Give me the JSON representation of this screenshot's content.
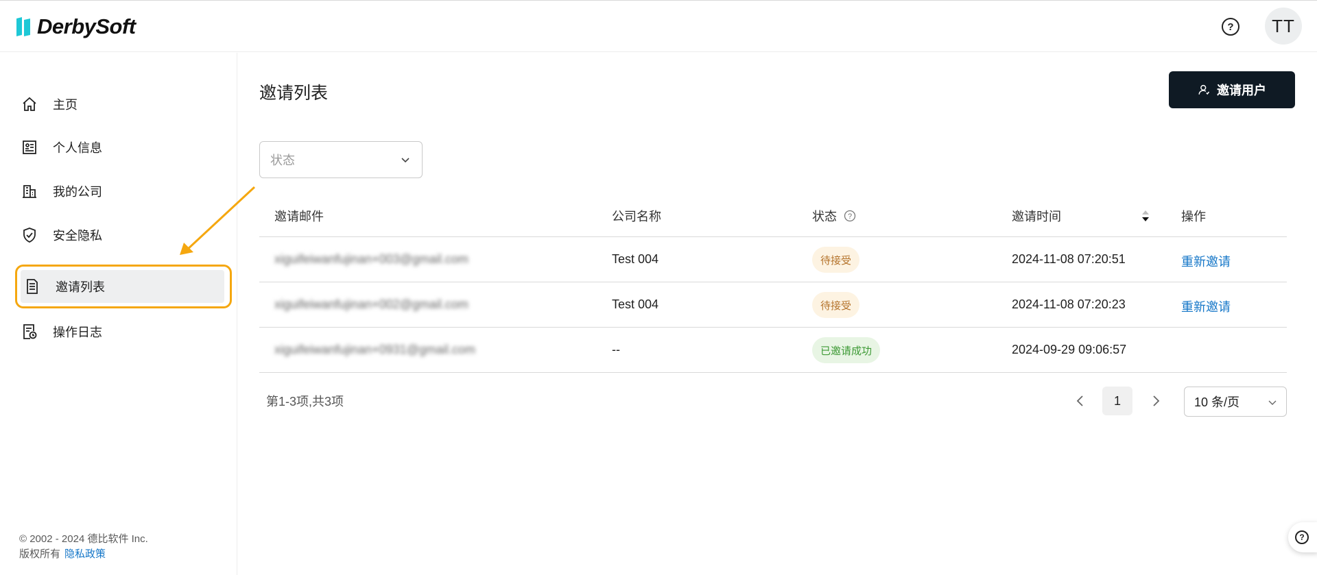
{
  "header": {
    "logo_text": "DerbySoft",
    "help_icon": "question-circle-icon",
    "avatar_initials": "TT"
  },
  "sidebar": {
    "items": [
      {
        "label": "主页",
        "icon": "home-icon"
      },
      {
        "label": "个人信息",
        "icon": "profile-card-icon"
      },
      {
        "label": "我的公司",
        "icon": "building-icon"
      },
      {
        "label": "安全隐私",
        "icon": "shield-check-icon"
      },
      {
        "label": "邀请列表",
        "icon": "document-list-icon",
        "active": true
      },
      {
        "label": "操作日志",
        "icon": "log-clock-icon"
      }
    ],
    "footer": {
      "copyright": "© 2002 - 2024 德比软件 Inc.",
      "rights": "版权所有",
      "privacy": "隐私政策"
    }
  },
  "main": {
    "title": "邀请列表",
    "invite_button": "邀请用户",
    "status_filter_placeholder": "状态",
    "table": {
      "columns": [
        "邀请邮件",
        "公司名称",
        "状态",
        "邀请时间",
        "操作"
      ],
      "rows": [
        {
          "email": "xiguifeiwanfujinan+003@gmail.com",
          "company": "Test 004",
          "status": "待接受",
          "status_type": "pending",
          "time": "2024-11-08 07:20:51",
          "action": "重新邀请"
        },
        {
          "email": "xiguifeiwanfujinan+002@gmail.com",
          "company": "Test 004",
          "status": "待接受",
          "status_type": "pending",
          "time": "2024-11-08 07:20:23",
          "action": "重新邀请"
        },
        {
          "email": "xiguifeiwanfujinan+0931@gmail.com",
          "company": "--",
          "status": "已邀请成功",
          "status_type": "success",
          "time": "2024-09-29 09:06:57",
          "action": ""
        }
      ]
    },
    "pagination": {
      "summary": "第1-3项,共3项",
      "current_page": "1",
      "page_size": "10 条/页"
    }
  },
  "colors": {
    "accent_highlight": "#f5a70f",
    "primary_button": "#0f1a24",
    "link": "#1677c8",
    "pending_badge_bg": "#fdf3e2",
    "success_badge_bg": "#e8f5e4"
  }
}
